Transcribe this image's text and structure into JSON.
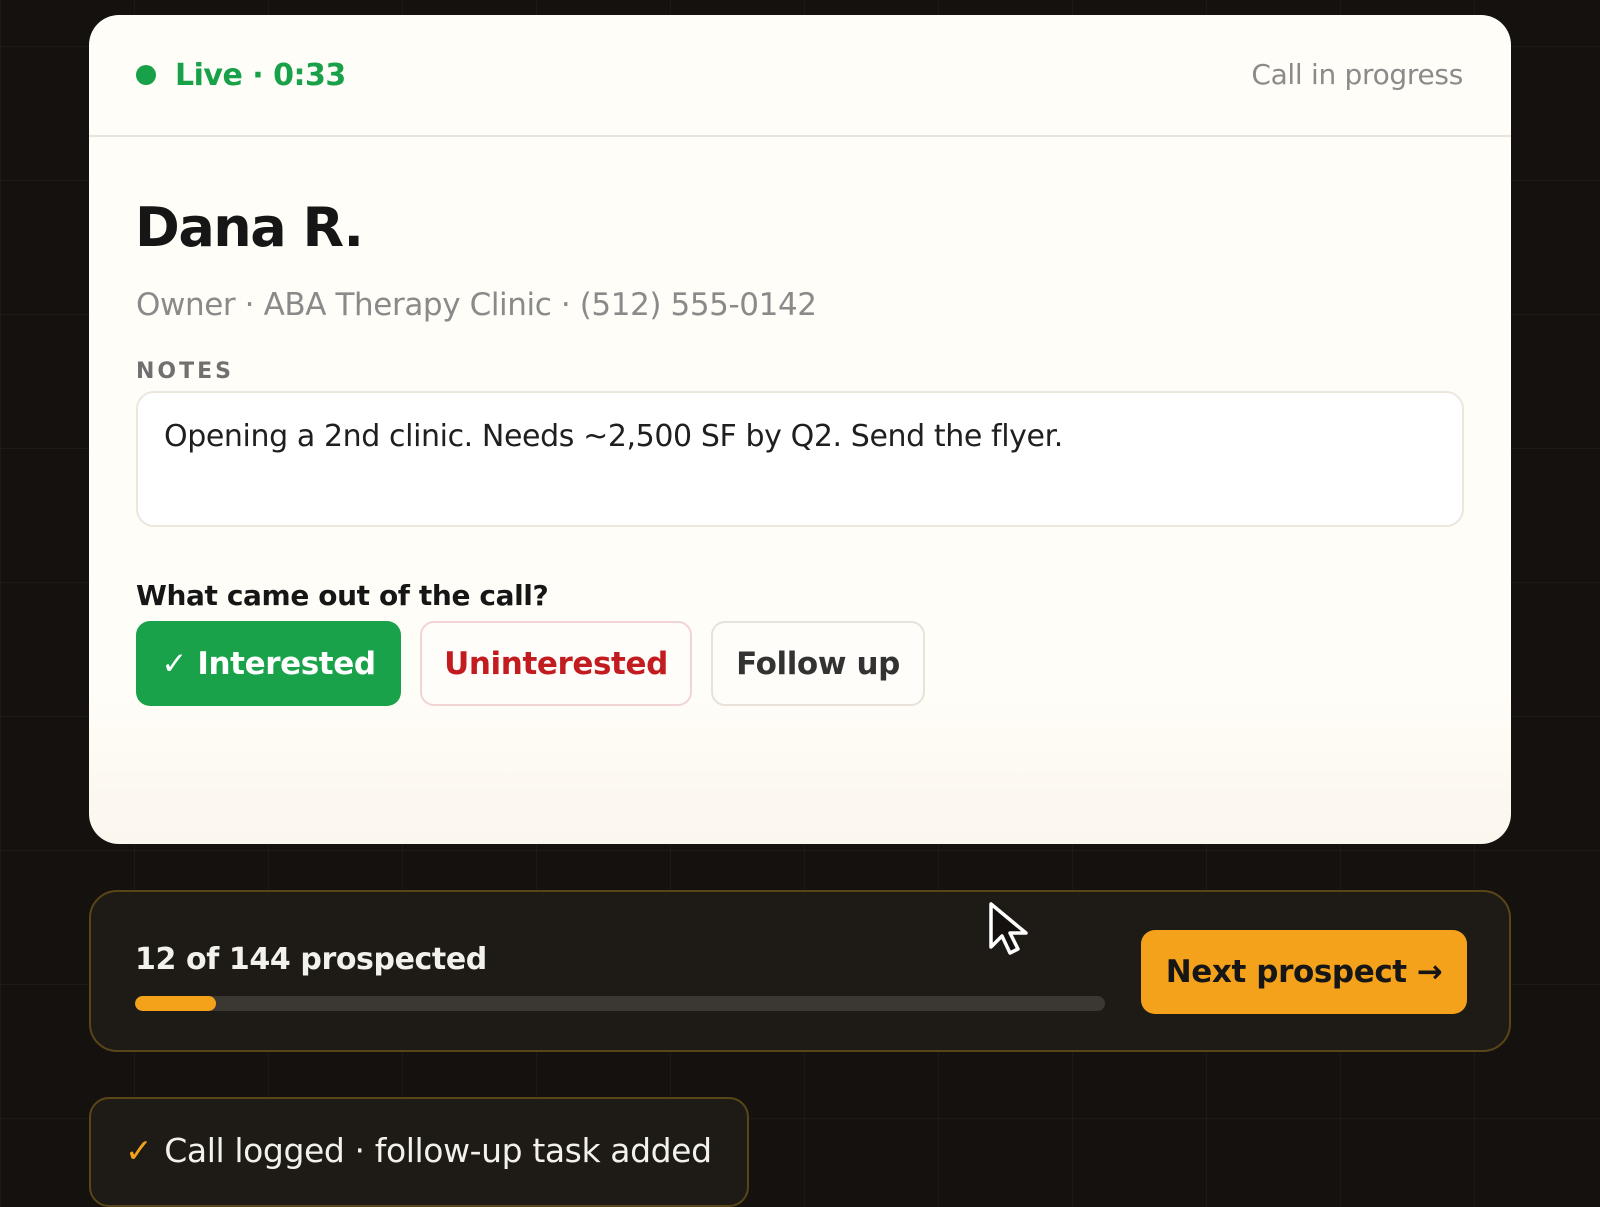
{
  "header": {
    "live_label": "Live · 0:33",
    "status": "Call in progress"
  },
  "prospect": {
    "name": "Dana R.",
    "subtitle": "Owner · ABA Therapy Clinic · (512) 555-0142"
  },
  "notes": {
    "label": "NOTES",
    "text": "Opening a 2nd clinic. Needs ~2,500 SF by Q2. Send the flyer."
  },
  "outcome": {
    "question": "What came out of the call?",
    "options": [
      {
        "label": "✓ Interested",
        "selected": true
      },
      {
        "label": "Uninterested",
        "selected": false
      },
      {
        "label": "Follow up",
        "selected": false
      }
    ]
  },
  "progress": {
    "label": "12 of 144 prospected",
    "completed": 12,
    "total": 144,
    "next_label": "Next prospect",
    "next_icon": "arrow-right-icon"
  },
  "toast": {
    "text": "Call logged · follow-up task added",
    "icon": "check-icon"
  },
  "colors": {
    "live_green": "#18a148",
    "interested_green": "#1aa24a",
    "uninterested_red": "#c21c21",
    "accent_orange": "#f4a21c",
    "card_background": "#fffdf7",
    "page_background": "#14110e"
  }
}
